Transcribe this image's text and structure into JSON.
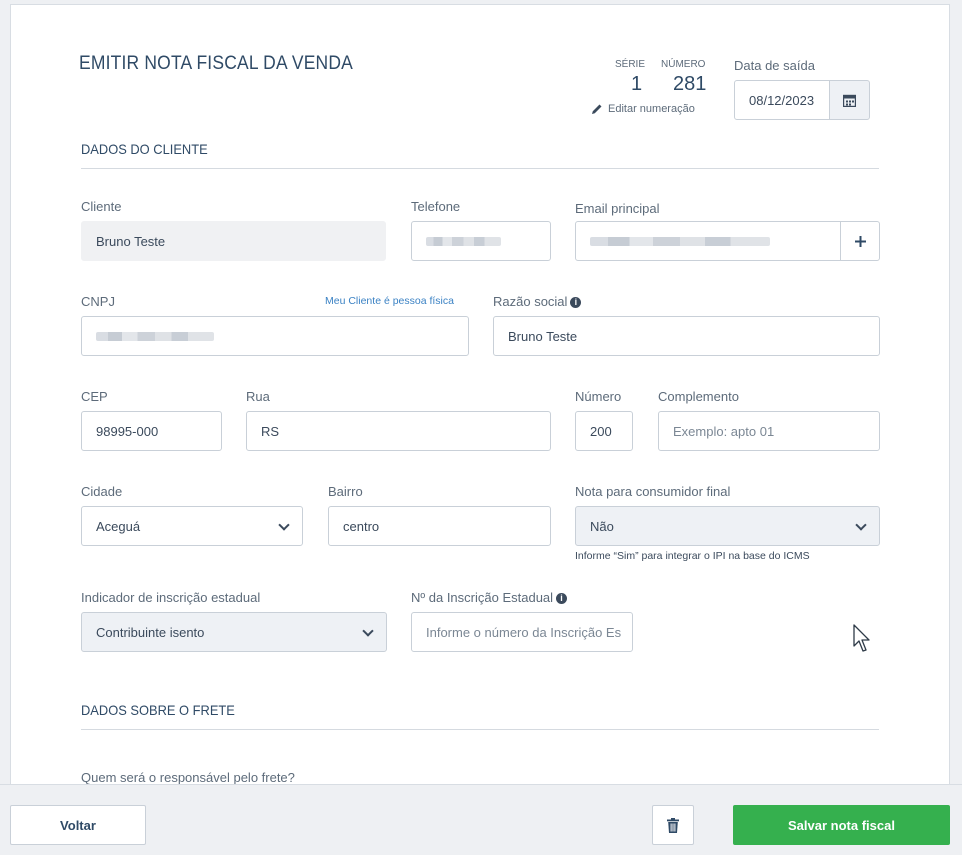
{
  "header": {
    "title": "EMITIR NOTA FISCAL DA VENDA",
    "serie_label": "SÉRIE",
    "serie_value": "1",
    "numero_label": "NÚMERO",
    "numero_value": "281",
    "edit_numbering": "Editar numeração",
    "date_label": "Data de saída",
    "date_value": "08/12/2023"
  },
  "client_section": {
    "title": "DADOS DO CLIENTE",
    "cliente_label": "Cliente",
    "cliente_value": "Bruno Teste",
    "telefone_label": "Telefone",
    "email_label": "Email principal",
    "cnpj_label": "CNPJ",
    "pessoa_fisica_link": "Meu Cliente é pessoa física",
    "razao_label": "Razão social",
    "razao_value": "Bruno Teste",
    "cep_label": "CEP",
    "cep_value": "98995-000",
    "rua_label": "Rua",
    "rua_value": "RS",
    "numero_label": "Número",
    "numero_value": "200",
    "complemento_label": "Complemento",
    "complemento_placeholder": "Exemplo: apto 01",
    "cidade_label": "Cidade",
    "cidade_value": "Aceguá",
    "bairro_label": "Bairro",
    "bairro_value": "centro",
    "consumidor_label": "Nota para consumidor final",
    "consumidor_value": "Não",
    "consumidor_hint": "Informe “Sim” para integrar o IPI na base do ICMS",
    "indicador_label": "Indicador de inscrição estadual",
    "indicador_value": "Contribuinte isento",
    "ie_label": "Nº da Inscrição Estadual",
    "ie_placeholder": "Informe o número da Inscrição Es"
  },
  "freight_section": {
    "title": "DADOS SOBRE O FRETE",
    "question": "Quem será o responsável pelo frete?"
  },
  "footer": {
    "back_label": "Voltar",
    "save_label": "Salvar nota fiscal"
  },
  "colors": {
    "primary_text": "#2f4a66",
    "save_green": "#35b04e",
    "link_blue": "#3b82c4"
  }
}
